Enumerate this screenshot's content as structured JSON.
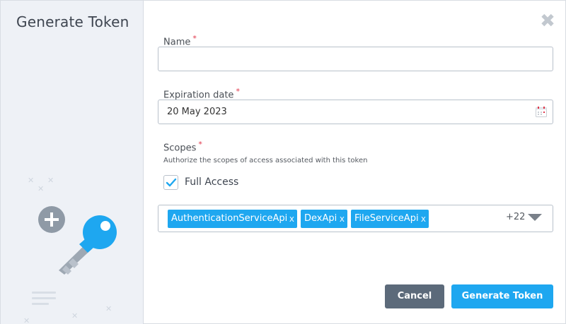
{
  "dialog": {
    "title": "Generate Token",
    "close_label": "✖"
  },
  "form": {
    "name": {
      "label": "Name",
      "required_mark": "*",
      "value": "",
      "placeholder": ""
    },
    "expiration": {
      "label": "Expiration date",
      "required_mark": "*",
      "value": "20 May 2023",
      "icon": "calendar-icon"
    },
    "scopes": {
      "label": "Scopes",
      "required_mark": "*",
      "hint": "Authorize the scopes of access associated with this token",
      "full_access_label": "Full Access",
      "full_access_checked": true,
      "selected": [
        {
          "label": "AuthenticationServiceApi",
          "remove": "x"
        },
        {
          "label": "DexApi",
          "remove": "x"
        },
        {
          "label": "FileServiceApi",
          "remove": "x"
        }
      ],
      "more_count": "+22"
    }
  },
  "buttons": {
    "cancel": "Cancel",
    "generate": "Generate Token"
  },
  "colors": {
    "accent": "#1ea7f0",
    "cancel_bg": "#5c6a7a",
    "side_bg": "#eef1f6",
    "required": "#e0364a"
  }
}
